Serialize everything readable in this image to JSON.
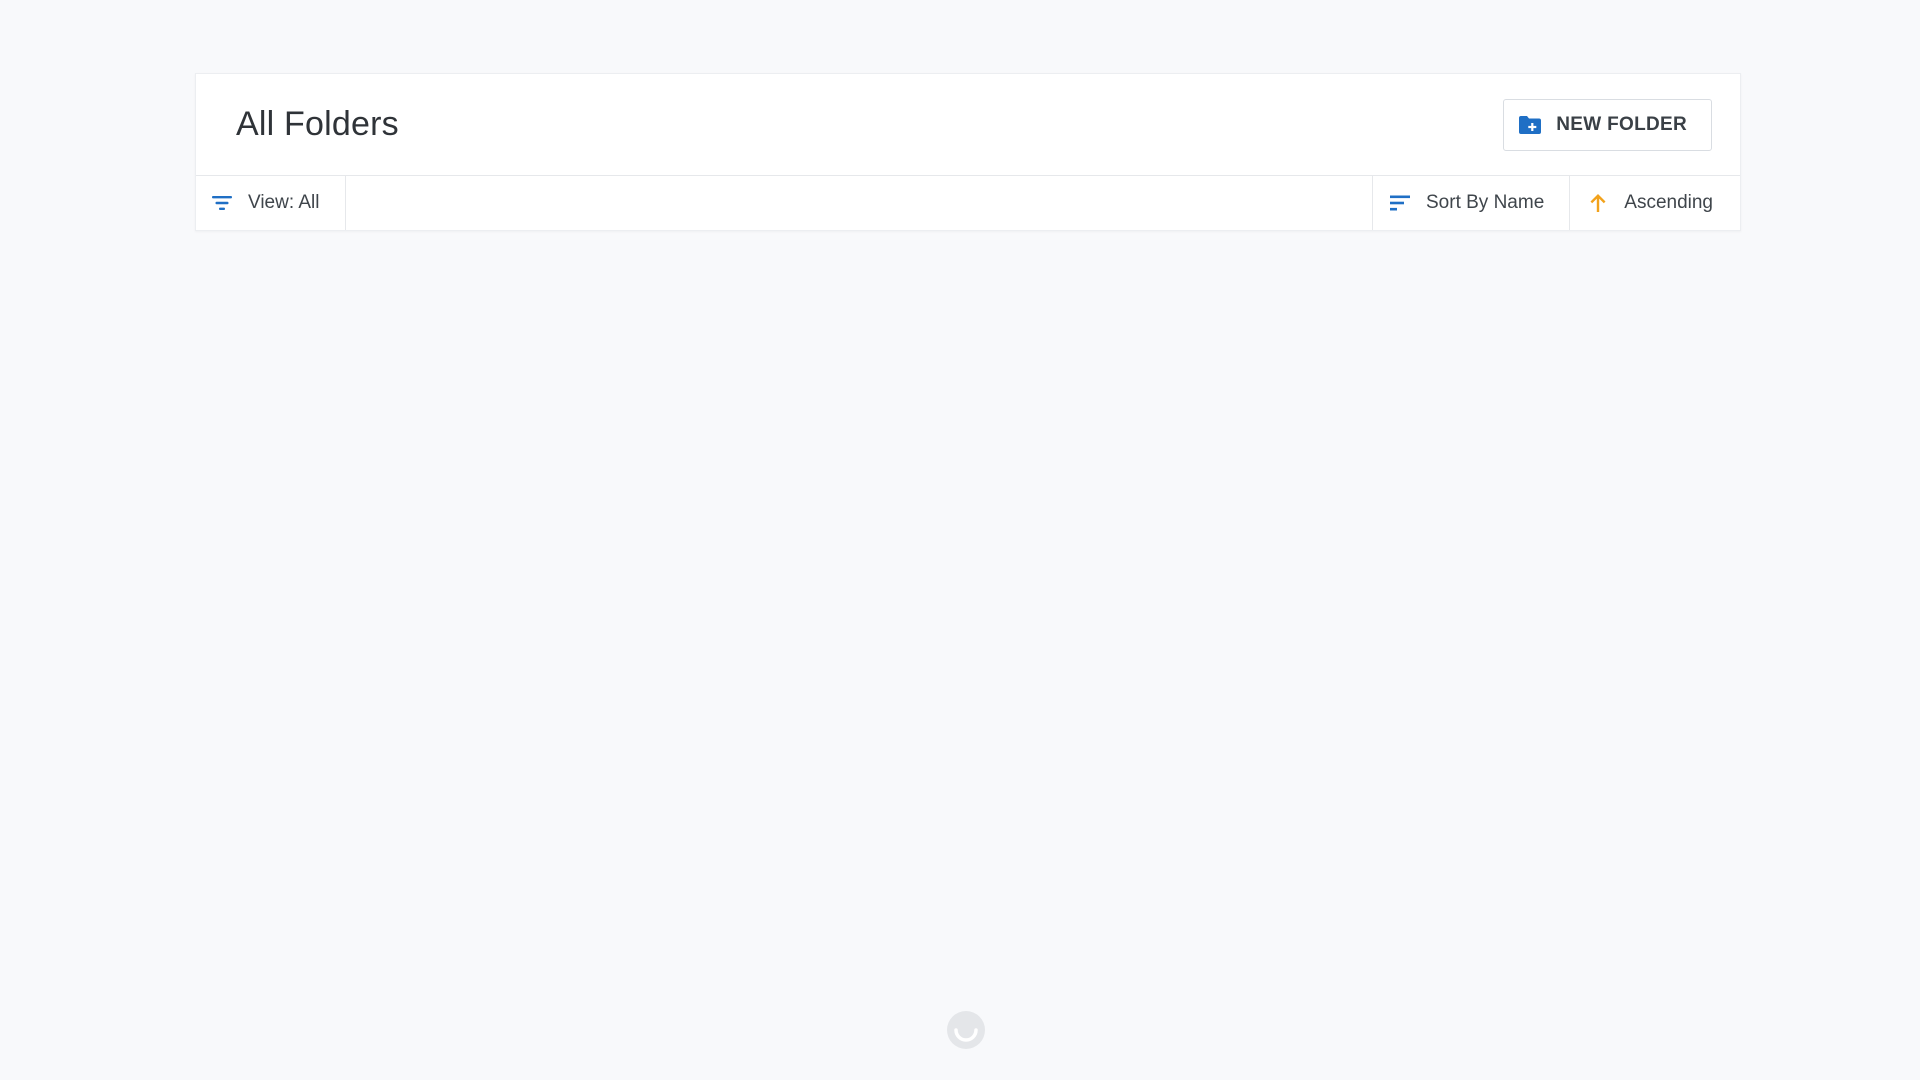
{
  "header": {
    "title": "All Folders",
    "new_folder_label": "NEW FOLDER"
  },
  "toolbar": {
    "view_label": "View: All",
    "sort_label": "Sort By Name",
    "direction_label": "Ascending"
  },
  "icons": {
    "new_folder": "folder-plus-icon",
    "filter": "filter-icon",
    "sort": "sort-lines-icon",
    "direction": "arrow-up-icon",
    "loading": "loading-spinner-icon"
  },
  "colors": {
    "accent_blue": "#1f6fc5",
    "accent_orange": "#f2a21b",
    "background": "#f8f9fb"
  }
}
